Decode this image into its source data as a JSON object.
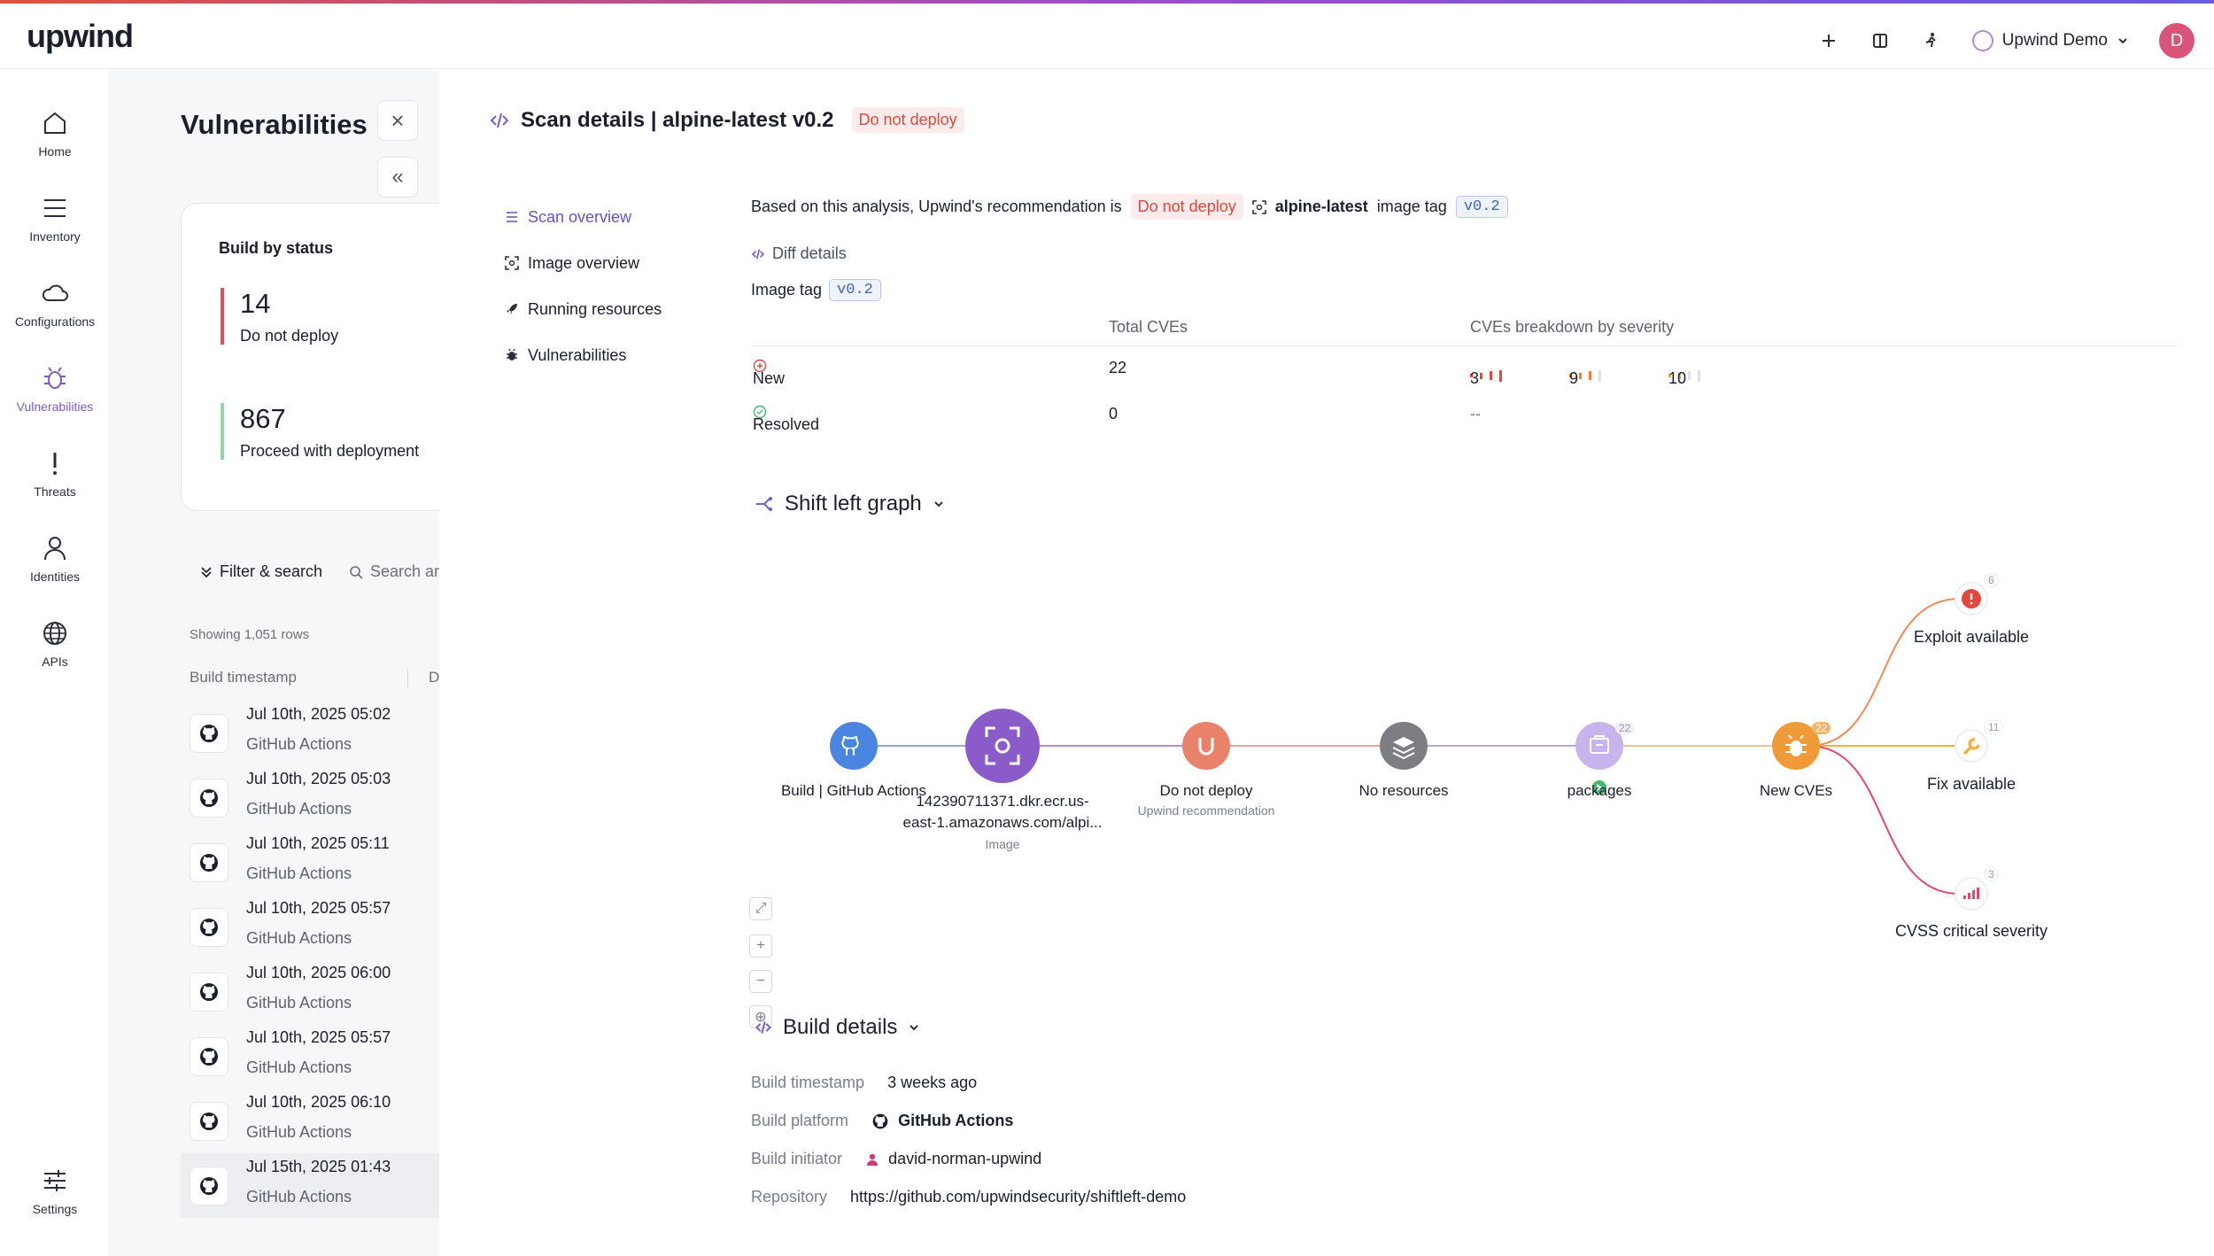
{
  "header": {
    "logo": "upwind",
    "tenant": "Upwind Demo",
    "avatar_initial": "D"
  },
  "nav": [
    {
      "label": "Home",
      "icon": "home-icon"
    },
    {
      "label": "Inventory",
      "icon": "list-icon"
    },
    {
      "label": "Configurations",
      "icon": "cloud-icon"
    },
    {
      "label": "Vulnerabilities",
      "icon": "bug-icon",
      "active": true
    },
    {
      "label": "Threats",
      "icon": "exclamation-icon"
    },
    {
      "label": "Identities",
      "icon": "person-icon"
    },
    {
      "label": "APIs",
      "icon": "globe-icon"
    },
    {
      "label": "Settings",
      "icon": "sliders-icon"
    }
  ],
  "panel": {
    "title": "Vulnerabilities",
    "status_title": "Build by status",
    "stats": [
      {
        "value": "14",
        "label": "Do not deploy"
      },
      {
        "value": "867",
        "label": "Proceed with deployment"
      }
    ],
    "filter_label": "Filter & search",
    "search_placeholder": "Search ar",
    "rows_count": "Showing 1,051 rows",
    "col_timestamp": "Build timestamp",
    "col_d": "D",
    "builds": [
      {
        "time": "Jul 10th, 2025 05:02",
        "source": "GitHub Actions"
      },
      {
        "time": "Jul 10th, 2025 05:03",
        "source": "GitHub Actions"
      },
      {
        "time": "Jul 10th, 2025 05:11",
        "source": "GitHub Actions"
      },
      {
        "time": "Jul 10th, 2025 05:57",
        "source": "GitHub Actions"
      },
      {
        "time": "Jul 10th, 2025 06:00",
        "source": "GitHub Actions"
      },
      {
        "time": "Jul 10th, 2025 05:57",
        "source": "GitHub Actions"
      },
      {
        "time": "Jul 10th, 2025 06:10",
        "source": "GitHub Actions"
      },
      {
        "time": "Jul 15th, 2025 01:43",
        "source": "GitHub Actions"
      }
    ]
  },
  "scan": {
    "title": "Scan details | alpine-latest v0.2",
    "badge": "Do not deploy",
    "subnav": [
      "Scan overview",
      "Image overview",
      "Running resources",
      "Vulnerabilities"
    ],
    "recommendation_prefix": "Based on this analysis, Upwind's recommendation is",
    "recommendation": "Do not deploy",
    "image_name": "alpine-latest",
    "image_tag_word": "image tag",
    "tag": "v0.2",
    "diff_title": "Diff details",
    "image_tag_label": "Image tag",
    "table": {
      "col_total": "Total CVEs",
      "col_breakdown": "CVEs breakdown by severity",
      "rows": [
        {
          "label": "New",
          "total": "22",
          "critical": "3",
          "high": "9",
          "medium": "10"
        },
        {
          "label": "Resolved",
          "total": "0",
          "breakdown": "--"
        }
      ]
    },
    "graph_title": "Shift left graph",
    "graph": {
      "nodes": [
        {
          "label": "Build | GitHub Actions",
          "sub": ""
        },
        {
          "label": "142390711371.dkr.ecr.us-",
          "label2": "east-1.amazonaws.com/alpi...",
          "sub": "Image"
        },
        {
          "label": "Do not deploy",
          "sub": "Upwind recommendation"
        },
        {
          "label": "No resources",
          "sub": ""
        },
        {
          "label": "packages",
          "count": "22"
        },
        {
          "label": "New CVEs",
          "count": "22"
        }
      ],
      "outcomes": [
        {
          "label": "Exploit available",
          "count": "6"
        },
        {
          "label": "Fix available",
          "count": "11"
        },
        {
          "label": "CVSS critical severity",
          "count": "3"
        }
      ]
    },
    "build_title": "Build details",
    "build": {
      "timestamp_label": "Build timestamp",
      "timestamp": "3 weeks ago",
      "platform_label": "Build platform",
      "platform": "GitHub Actions",
      "initiator_label": "Build initiator",
      "initiator": "david-norman-upwind",
      "repo_label": "Repository",
      "repo": "https://github.com/upwindsecurity/shiftleft-demo"
    }
  },
  "colors": {
    "accent": "#7b5cc7",
    "danger": "#e2483c",
    "success": "#46b86e",
    "github_node": "#4a86e0",
    "image_node": "#8a5bc9",
    "recommend_node": "#e8826a",
    "resources_node": "#7d7d84",
    "packages_node": "#c7b4ec",
    "cve_node": "#f19a3a"
  }
}
